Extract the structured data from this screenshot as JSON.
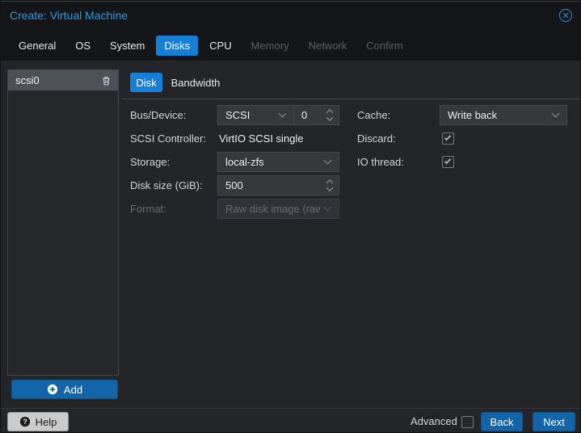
{
  "window": {
    "title": "Create: Virtual Machine"
  },
  "wizard_tabs": [
    {
      "label": "General",
      "state": "enabled"
    },
    {
      "label": "OS",
      "state": "enabled"
    },
    {
      "label": "System",
      "state": "enabled"
    },
    {
      "label": "Disks",
      "state": "active"
    },
    {
      "label": "CPU",
      "state": "enabled"
    },
    {
      "label": "Memory",
      "state": "disabled"
    },
    {
      "label": "Network",
      "state": "disabled"
    },
    {
      "label": "Confirm",
      "state": "disabled"
    }
  ],
  "disk_list": {
    "items": [
      {
        "label": "scsi0",
        "selected": true
      }
    ],
    "add_button_label": "Add"
  },
  "disk_tabs": [
    {
      "label": "Disk",
      "active": true
    },
    {
      "label": "Bandwidth",
      "active": false
    }
  ],
  "disk_form": {
    "bus_device_label": "Bus/Device:",
    "bus_value": "SCSI",
    "device_number": "0",
    "scsi_controller_label": "SCSI Controller:",
    "scsi_controller_value": "VirtIO SCSI single",
    "storage_label": "Storage:",
    "storage_value": "local-zfs",
    "disk_size_label": "Disk size (GiB):",
    "disk_size_value": "500",
    "format_label": "Format:",
    "format_value": "Raw disk image (raw",
    "format_disabled": true,
    "cache_label": "Cache:",
    "cache_value": "Write back",
    "discard_label": "Discard:",
    "discard_checked": true,
    "io_thread_label": "IO thread:",
    "io_thread_checked": true
  },
  "footer": {
    "help_label": "Help",
    "advanced_label": "Advanced",
    "advanced_checked": false,
    "back_label": "Back",
    "next_label": "Next"
  },
  "colors": {
    "accent_tab_blue": "#1480d8",
    "button_blue": "#1165a8",
    "title_blue": "#3399e0",
    "dialog_bg": "#242529",
    "header_bg": "#15161a",
    "field_bg": "#37383c"
  }
}
